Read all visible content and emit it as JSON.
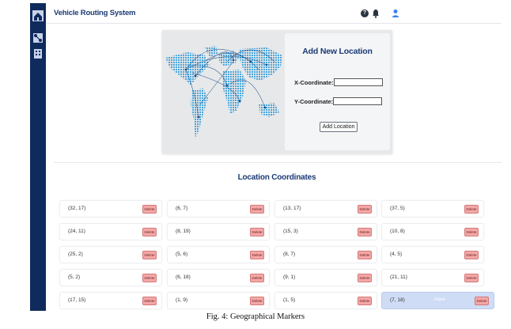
{
  "header": {
    "title": "Vehicle Routing System",
    "help_label": "?"
  },
  "sidebar": {
    "icons": [
      "home-icon",
      "route-icon",
      "building-icon"
    ]
  },
  "form": {
    "title": "Add New Location",
    "x_label": "X-Coordinate:",
    "y_label": "Y-Coordinate:",
    "x_value": "",
    "y_value": "",
    "button_label": "Add Location"
  },
  "locations": {
    "title": "Location Coordinates",
    "delete_label": "Delete",
    "highlight_label": "Depot",
    "items": [
      {
        "coord": "(32, 17)"
      },
      {
        "coord": "(6, 7)"
      },
      {
        "coord": "(13, 17)"
      },
      {
        "coord": "(37, 5)"
      },
      {
        "coord": "(24, 11)"
      },
      {
        "coord": "(8, 19)"
      },
      {
        "coord": "(15, 3)"
      },
      {
        "coord": "(10, 8)"
      },
      {
        "coord": "(25, 2)"
      },
      {
        "coord": "(5, 6)"
      },
      {
        "coord": "(8, 7)"
      },
      {
        "coord": "(4, 5)"
      },
      {
        "coord": "(5, 2)"
      },
      {
        "coord": "(6, 18)"
      },
      {
        "coord": "(9, 1)"
      },
      {
        "coord": "(21, 11)"
      },
      {
        "coord": "(17, 15)"
      },
      {
        "coord": "(1, 9)"
      },
      {
        "coord": "(1, 5)"
      },
      {
        "coord": "(7, 18)",
        "depot": true
      }
    ]
  },
  "caption": "Fig. 4: Geographical Markers",
  "colors": {
    "sidebar": "#0f2a5c",
    "title": "#1b3a75",
    "delete": "#f4a8a8",
    "depot": "#cfdcf6"
  }
}
